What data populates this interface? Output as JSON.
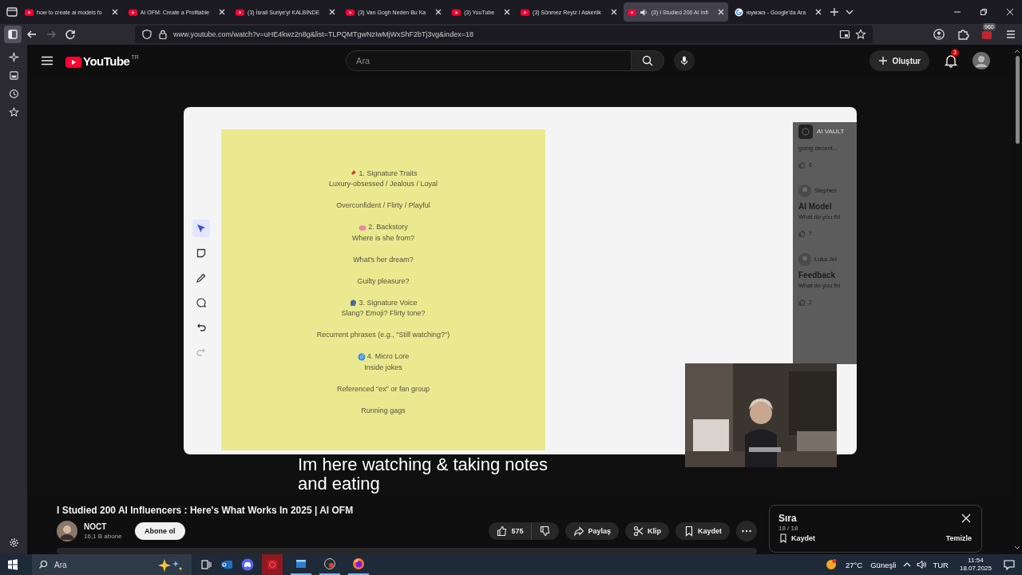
{
  "browser": {
    "tabs": [
      {
        "title": "how to create ai models fo",
        "kind": "youtube",
        "selected": false,
        "audio": false
      },
      {
        "title": "AI OFM: Create a Profitable",
        "kind": "youtube",
        "selected": false,
        "audio": false
      },
      {
        "title": "(3) İsrail Suriye'yi KALBİNDE",
        "kind": "youtube",
        "selected": false,
        "audio": false
      },
      {
        "title": "(3) Van Gogh Neden Bu Ka",
        "kind": "youtube",
        "selected": false,
        "audio": false
      },
      {
        "title": "(3) YouTube",
        "kind": "youtube",
        "selected": false,
        "audio": false
      },
      {
        "title": "(3) Sönmez Reyiz I Askerlik",
        "kind": "youtube",
        "selected": false,
        "audio": false
      },
      {
        "title": "(3) I Studied 200 AI Infl",
        "kind": "youtube",
        "selected": true,
        "audio": true
      },
      {
        "title": "юумэкэ - Google'da Ara",
        "kind": "google",
        "selected": false,
        "audio": false
      }
    ],
    "url": "www.youtube.com/watch?v=uHE4kwz2n8g&list=TLPQMTgwNzIwMjWxShF2bTj3vg&index=18",
    "extension_badge": "960"
  },
  "youtube": {
    "logo": "YouTube",
    "region": "TR",
    "search_placeholder": "Ara",
    "create_label": "Oluştur",
    "notifications": "3"
  },
  "video": {
    "note": {
      "sections": [
        {
          "kind": "pin",
          "heading": "1. Signature Traits",
          "lines": [
            "Luxury-obsessed / Jealous / Loyal",
            "Overconfident / Flirty / Playful"
          ]
        },
        {
          "kind": "brain",
          "heading": "2. Backstory",
          "lines": [
            "Where is she from?",
            "What's her dream?",
            "Guilty pleasure?"
          ]
        },
        {
          "kind": "voice",
          "heading": "3. Signature Voice",
          "lines": [
            "Slang? Emoji? Flirty tone?",
            "Recurrent phrases (e.g., \"Still watching?\")"
          ]
        },
        {
          "kind": "spiral",
          "heading": "4. Micro Lore",
          "lines": [
            "Inside jokes",
            "Referenced \"ex\" or fan group",
            "Running gags"
          ]
        }
      ]
    },
    "tools": [
      {
        "kind": "select",
        "selected": true,
        "disabled": false
      },
      {
        "kind": "note",
        "selected": false,
        "disabled": false
      },
      {
        "kind": "pen",
        "selected": false,
        "disabled": false
      },
      {
        "kind": "comment",
        "selected": false,
        "disabled": false
      },
      {
        "kind": "undo",
        "selected": false,
        "disabled": false
      },
      {
        "kind": "redo",
        "selected": false,
        "disabled": true
      }
    ],
    "panel": {
      "title": "AI VAULT",
      "snippet": "going decent...",
      "snippet_likes": "6",
      "posts": [
        {
          "author": "Stephen",
          "title": "AI Model",
          "excerpt": "What do you thi",
          "likes": "7"
        },
        {
          "author": "Luka Jel",
          "title": "Feedback",
          "excerpt": "What do you thi",
          "likes": "2"
        }
      ]
    },
    "subtitles": [
      "Im here watching & taking notes",
      "and eating"
    ]
  },
  "title": "I Studied 200 AI Influencers : Here's What Works In 2025 | AI OFM",
  "channel": {
    "name": "NOCT",
    "subscribers": "16,1 B abone",
    "subscribe": "Abone ol"
  },
  "actions": {
    "likes": "575",
    "share": "Paylaş",
    "clip": "Klip",
    "save": "Kaydet"
  },
  "queue": {
    "title": "Sıra",
    "position": "18 / 18",
    "save": "Kaydet",
    "clear": "Temizle"
  },
  "taskbar": {
    "search": "Ara",
    "temperature": "27°C",
    "weather": "Güneşli",
    "language": "TUR",
    "time": "11:54",
    "date": "18.07.2025"
  }
}
